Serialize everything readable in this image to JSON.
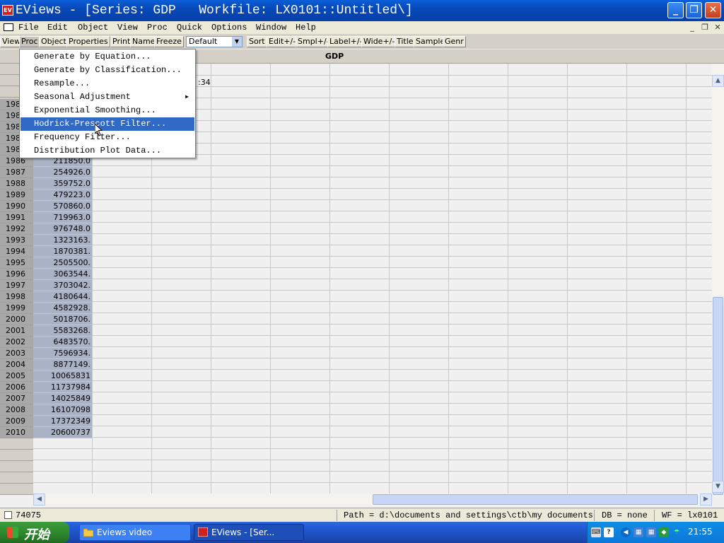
{
  "window": {
    "title": "EViews - [Series: GDP   Workfile: LX0101::Untitled\\]",
    "minimize": "_",
    "maximize": "❐",
    "close": "✕"
  },
  "menubar": [
    "File",
    "Edit",
    "Object",
    "View",
    "Proc",
    "Quick",
    "Options",
    "Window",
    "Help"
  ],
  "mdi": {
    "minimize": "_",
    "restore": "❐",
    "close": "✕"
  },
  "toolbar": {
    "buttons": [
      "View",
      "Proc",
      "Object",
      "Properties",
      "Print",
      "Name",
      "Freeze"
    ],
    "display": "Default",
    "buttons2": [
      "Sort",
      "Edit+/-",
      "Smpl+/-",
      "Label+/-",
      "Wide+/-",
      "Title",
      "Sample",
      "Genr"
    ]
  },
  "sheet": {
    "series_name": "GDP",
    "modified_fragment": ":34",
    "rows": [
      {
        "year": "198",
        "value": ""
      },
      {
        "year": "198",
        "value": ""
      },
      {
        "year": "198",
        "value": ""
      },
      {
        "year": "198",
        "value": ""
      },
      {
        "year": "198",
        "value": ""
      },
      {
        "year": "1986",
        "value": "211850.0"
      },
      {
        "year": "1987",
        "value": "254926.0"
      },
      {
        "year": "1988",
        "value": "359752.0"
      },
      {
        "year": "1989",
        "value": "479223.0"
      },
      {
        "year": "1990",
        "value": "570860.0"
      },
      {
        "year": "1991",
        "value": "719963.0"
      },
      {
        "year": "1992",
        "value": "976748.0"
      },
      {
        "year": "1993",
        "value": "1323163."
      },
      {
        "year": "1994",
        "value": "1870381."
      },
      {
        "year": "1995",
        "value": "2505500."
      },
      {
        "year": "1996",
        "value": "3063544."
      },
      {
        "year": "1997",
        "value": "3703042."
      },
      {
        "year": "1998",
        "value": "4180644."
      },
      {
        "year": "1999",
        "value": "4582928."
      },
      {
        "year": "2000",
        "value": "5018706."
      },
      {
        "year": "2001",
        "value": "5583268."
      },
      {
        "year": "2002",
        "value": "6483570."
      },
      {
        "year": "2003",
        "value": "7596934."
      },
      {
        "year": "2004",
        "value": "8877149."
      },
      {
        "year": "2005",
        "value": "10065831"
      },
      {
        "year": "2006",
        "value": "11737984"
      },
      {
        "year": "2007",
        "value": "14025849"
      },
      {
        "year": "2008",
        "value": "16107098"
      },
      {
        "year": "2009",
        "value": "17372349"
      },
      {
        "year": "2010",
        "value": "20600737"
      }
    ]
  },
  "proc_menu": {
    "items": [
      "Generate by Equation...",
      "Generate by Classification...",
      "Resample...",
      "Seasonal Adjustment",
      "Exponential Smoothing...",
      "Hodrick-Prescott Filter...",
      "Frequency Filter...",
      "Distribution Plot Data..."
    ],
    "highlighted": "Hodrick-Prescott Filter...",
    "submenu_arrow": "▶"
  },
  "statusbar": {
    "command": "74075",
    "path": "Path = d:\\documents and settings\\ctb\\my documents",
    "db": "DB = none",
    "wf": "WF = lx0101"
  },
  "taskbar": {
    "start_label": "开始",
    "tasks": [
      "Eviews video",
      "EViews - [Ser..."
    ],
    "clock": "21:55"
  },
  "colors": {
    "titlebar": "#0848b8",
    "menu_highlight": "#316ac5",
    "selected_column": "#aab3c6",
    "taskbar": "#245edb",
    "start_button": "#2e8a2e"
  }
}
